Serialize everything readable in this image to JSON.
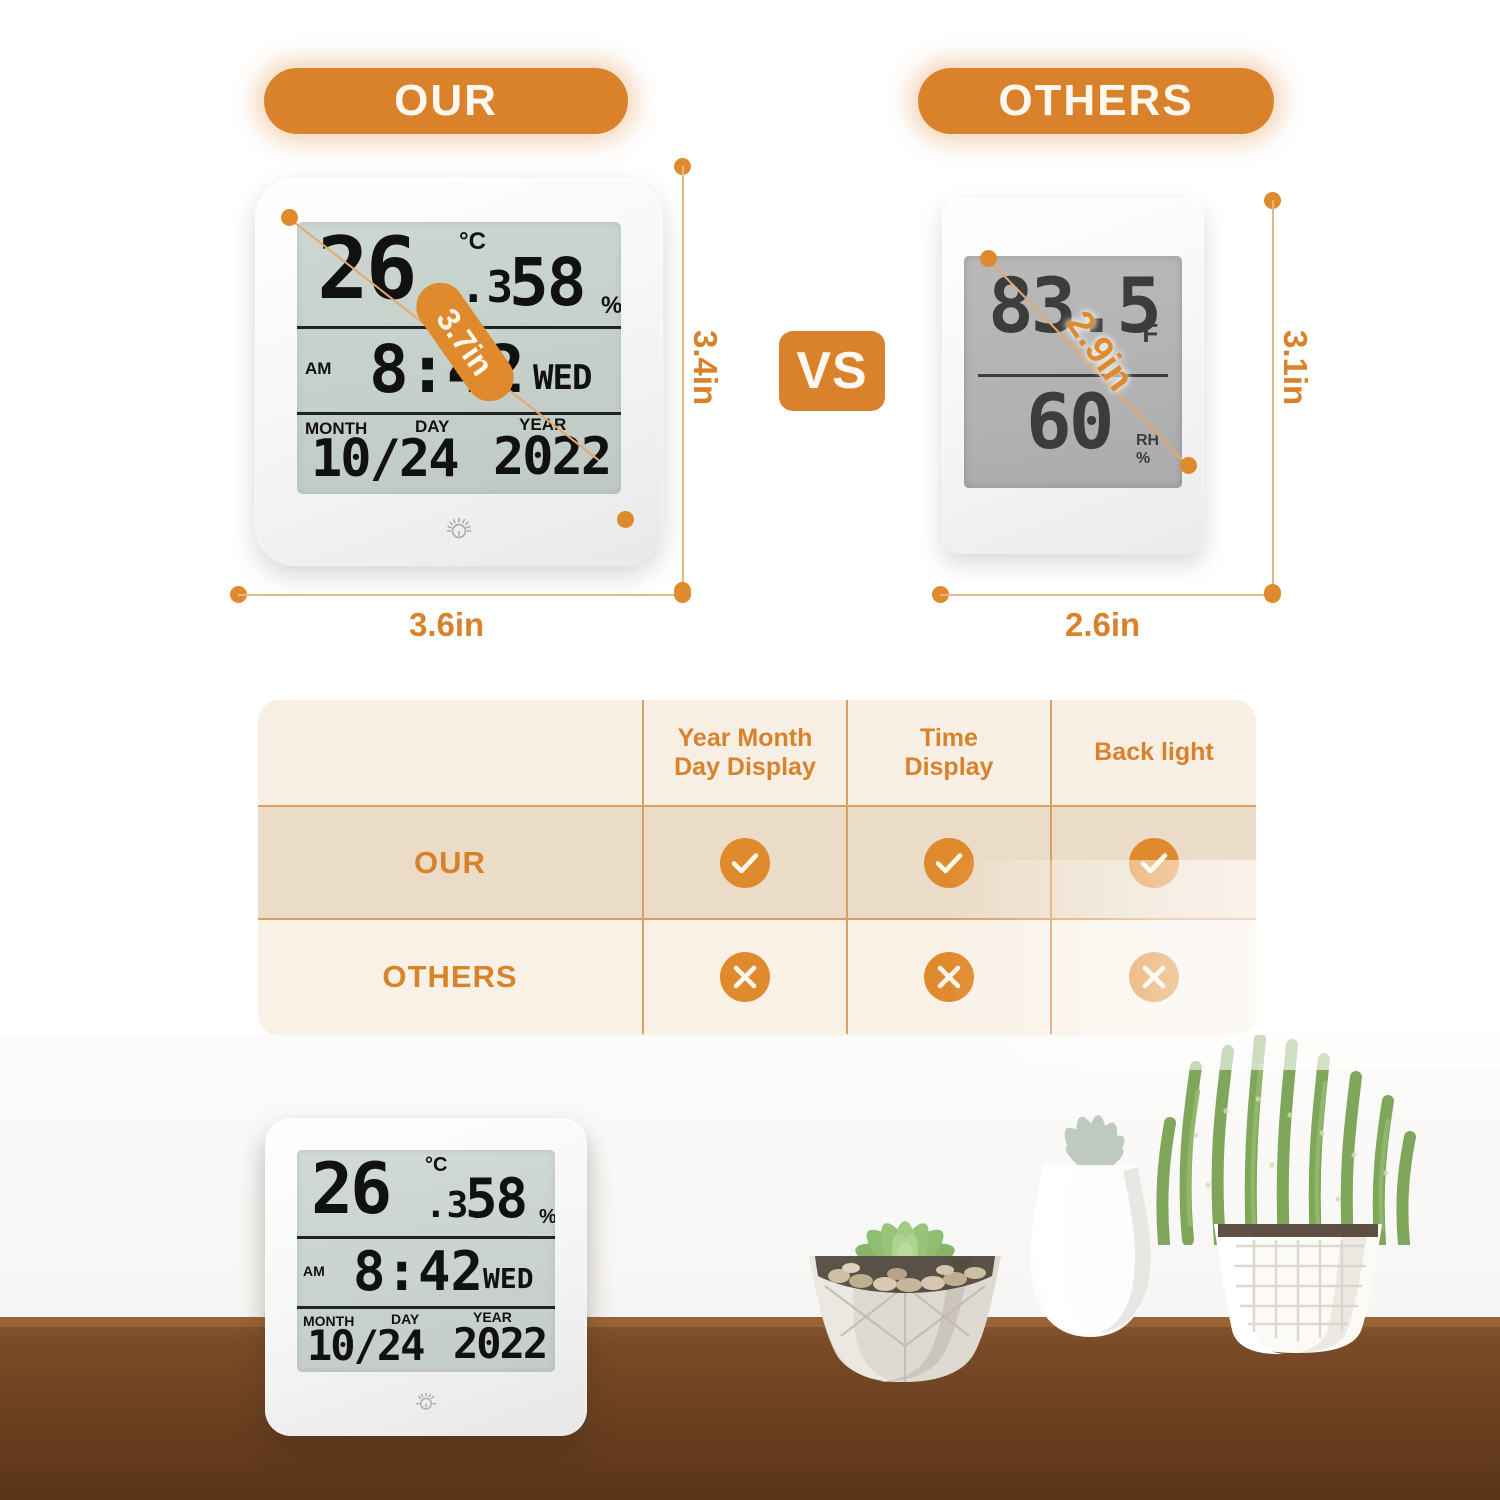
{
  "badges": {
    "our": "OUR",
    "others": "OTHERS",
    "vs": "VS"
  },
  "our_device": {
    "temperature": "26",
    "temperature_decimal": ".3",
    "temperature_unit": "°C",
    "humidity": "58",
    "humidity_unit": "%",
    "meridiem": "AM",
    "time": "8:42",
    "weekday": "WED",
    "label_month": "MONTH",
    "label_day": "DAY",
    "label_year": "YEAR",
    "date": "10/24",
    "year": "2022",
    "backlight_icon": "lightbulb-icon",
    "dimensions": {
      "width": "3.6in",
      "height": "3.4in",
      "diagonal": "3.7in"
    }
  },
  "others_device": {
    "temperature": "83.5",
    "temperature_unit": "°F",
    "humidity": "60",
    "humidity_label": "RH",
    "humidity_unit": "%",
    "dimensions": {
      "width": "2.6in",
      "height": "3.1in",
      "diagonal": "2.9in"
    }
  },
  "comparison_table": {
    "columns": [
      "",
      "Year Month\nDay Display",
      "Time\nDisplay",
      "Back light"
    ],
    "column_labels": [
      {
        "line1": "Year Month",
        "line2": "Day Display"
      },
      {
        "line1": "Time",
        "line2": "Display"
      },
      {
        "line1": "Back light",
        "line2": ""
      }
    ],
    "rows": [
      {
        "label": "OUR",
        "values": [
          "check",
          "check",
          "check"
        ]
      },
      {
        "label": "OTHERS",
        "values": [
          "cross",
          "cross",
          "cross"
        ]
      }
    ]
  },
  "bottom_scene": {
    "device": {
      "temperature": "26",
      "temperature_decimal": ".3",
      "temperature_unit": "°C",
      "humidity": "58",
      "humidity_unit": "%",
      "meridiem": "AM",
      "time": "8:42",
      "weekday": "WED",
      "label_month": "MONTH",
      "label_day": "DAY",
      "label_year": "YEAR",
      "date": "10/24",
      "year": "2022"
    }
  },
  "colors": {
    "accent_orange": "#D9822B",
    "dim_orange": "#E08A2E",
    "dim_line": "#E7B684",
    "table_header_bg": "#F7EFE4",
    "table_our_bg": "#EBDCC7",
    "table_others_bg": "#F9F1E6",
    "table_border": "#D9A066",
    "lcd_our": "#c9d3ce",
    "lcd_others": "#b4b4b4",
    "wood": "#6E4121"
  }
}
